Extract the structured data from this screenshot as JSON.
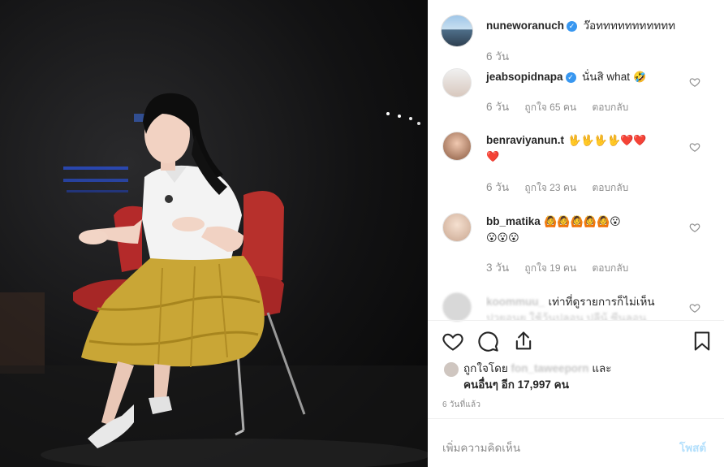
{
  "post": {
    "author": {
      "username": "nuneworanuch",
      "verified": true,
      "caption": "ว๊อททททททททททท",
      "age": "6 วัน"
    },
    "comments": [
      {
        "username": "jeabsopidnapa",
        "verified": true,
        "text": "นั่นสิ what",
        "emoji": "🤣",
        "age": "6 วัน",
        "likes": "ถูกใจ 65 คน",
        "reply": "ตอบกลับ"
      },
      {
        "username": "benraviyanun.t",
        "verified": false,
        "text": "",
        "emoji": "🖖🖖🖖🖖❤️❤️",
        "emoji2": "❤️",
        "age": "6 วัน",
        "likes": "ถูกใจ 23 คน",
        "reply": "ตอบกลับ"
      },
      {
        "username": "bb_matika",
        "verified": false,
        "text": "",
        "emoji": "🙆🙆🙆🙆🙆😮",
        "emoji2": "😮😮😮",
        "age": "3 วัน",
        "likes": "ถูกใจ 19 คน",
        "reply": "ตอบกลับ"
      },
      {
        "username": "koommuu_",
        "verified": false,
        "text": "เท่าที่ดูรายการก็ไม่เห็น",
        "line2": "ปวยอนย ใช้ว้นปลอน ปลีน้ ซีนลอน"
      }
    ],
    "liked_by_label": "ถูกใจโดย",
    "liked_by_user": "fon_taweeporn",
    "and_label": "และ",
    "others_label": "คนอื่นๆ อีก 17,997 คน",
    "time_ago": "6 วันที่แล้ว",
    "add_comment_placeholder": "เพิ่มความคิดเห็น",
    "post_button": "โพสต์"
  },
  "icons": [
    "verified-badge-icon",
    "heart-icon",
    "comment-icon",
    "share-icon",
    "bookmark-icon"
  ],
  "colors": {
    "verified": "#3897f0",
    "post_button": "#b2dffc",
    "muted": "#8e8e8e"
  }
}
